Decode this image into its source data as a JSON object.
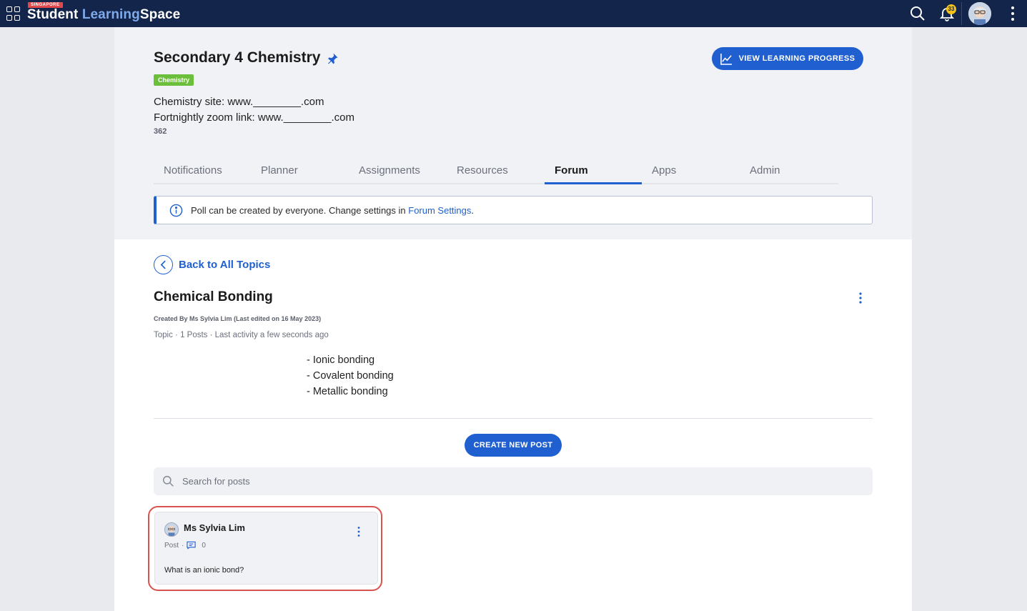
{
  "topbar": {
    "logo_tag": "SINGAPORE",
    "logo_primary": "Student",
    "logo_accent": "Learning",
    "logo_secondary": "Space",
    "notification_count": "33"
  },
  "course": {
    "title": "Secondary 4 Chemistry",
    "subject_chip": "Chemistry",
    "description_lines": [
      "Chemistry site: www.________.com",
      "Fortnightly zoom link: www.________.com"
    ],
    "count": "362",
    "view_progress_label": "VIEW LEARNING PROGRESS"
  },
  "tabs": [
    {
      "label": "Notifications",
      "active": false
    },
    {
      "label": "Planner",
      "active": false
    },
    {
      "label": "Assignments",
      "active": false
    },
    {
      "label": "Resources",
      "active": false
    },
    {
      "label": "Forum",
      "active": true
    },
    {
      "label": "Apps",
      "active": false
    },
    {
      "label": "Admin",
      "active": false
    }
  ],
  "info_banner": {
    "text": "Poll can be created by everyone. Change settings in ",
    "link": "Forum Settings",
    "suffix": "."
  },
  "back_link": "Back to All Topics",
  "topic": {
    "title": "Chemical Bonding",
    "created_by": "Created By Ms Sylvia Lim  (Last edited on 16 May 2023)",
    "meta": "Topic · 1 Posts · Last activity a few seconds ago",
    "bullets": [
      "- Ionic bonding",
      "- Covalent bonding",
      "- Metallic bonding"
    ]
  },
  "create_post_label": "CREATE NEW POST",
  "search": {
    "placeholder": "Search for posts"
  },
  "post": {
    "author": "Ms Sylvia Lim",
    "type": "Post",
    "comments": "0",
    "body": "What is an ionic bond?"
  },
  "colors": {
    "topbar": "#13254a",
    "primary": "#1f5fcf",
    "chip": "#6cbf3a",
    "highlight": "#d9534f",
    "badge": "#f5c21a"
  }
}
